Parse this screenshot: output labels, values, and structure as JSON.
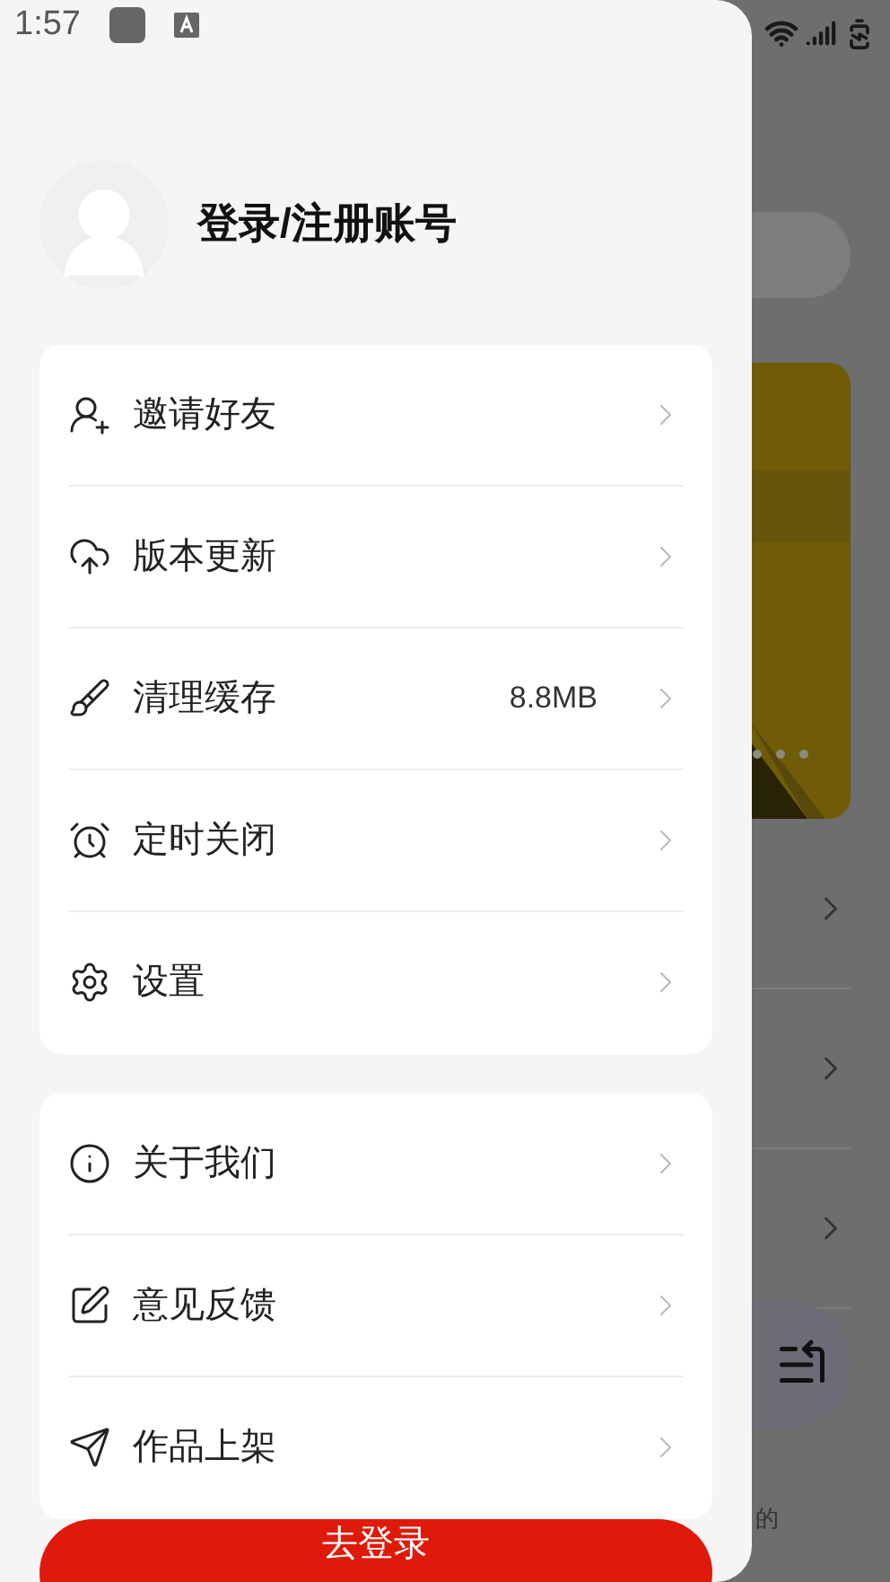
{
  "status_bar": {
    "time": "1:57"
  },
  "profile": {
    "login_label": "登录/注册账号"
  },
  "menu_groups": [
    {
      "items": [
        {
          "label": "邀请好友"
        },
        {
          "label": "版本更新"
        },
        {
          "label": "清理缓存",
          "value": "8.8MB"
        },
        {
          "label": "定时关闭"
        },
        {
          "label": "设置"
        }
      ]
    },
    {
      "items": [
        {
          "label": "关于我们"
        },
        {
          "label": "意见反馈"
        },
        {
          "label": "作品上架"
        }
      ]
    }
  ],
  "login_button": "去登录",
  "background": {
    "nav_label": "的"
  }
}
